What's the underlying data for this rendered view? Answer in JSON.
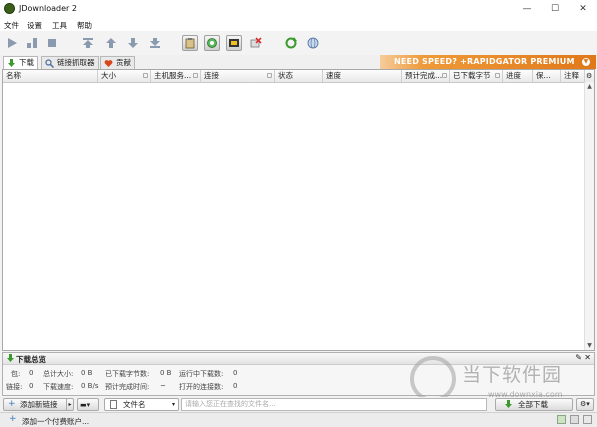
{
  "window": {
    "title": "JDownloader 2",
    "minimize": "—",
    "maximize": "☐",
    "close": "✕"
  },
  "menu": [
    "文件",
    "设置",
    "工具",
    "帮助"
  ],
  "tabs": [
    {
      "label": "下载",
      "icon": "download-icon"
    },
    {
      "label": "链接抓取器",
      "icon": "linkgrabber-icon"
    },
    {
      "label": "贡献",
      "icon": "heart-icon"
    }
  ],
  "promo": "NEED SPEED? +RAPIDGATOR PREMIUM",
  "columns": [
    "名称",
    "大小",
    "主机服务...",
    "连接",
    "状态",
    "速度",
    "预计完成...",
    "已下载字节",
    "进度",
    "保...",
    "注释"
  ],
  "summary": {
    "title": "下载总览",
    "row1": [
      {
        "label": "包:",
        "value": "0"
      },
      {
        "label": "总计大小:",
        "value": "0 B"
      },
      {
        "label": "已下载字节数:",
        "value": "0 B"
      },
      {
        "label": "运行中下载数:",
        "value": "0"
      }
    ],
    "row2": [
      {
        "label": "链接:",
        "value": "0"
      },
      {
        "label": "下载速度:",
        "value": "0 B/s"
      },
      {
        "label": "预计完成时间:",
        "value": "~"
      },
      {
        "label": "打开的连接数:",
        "value": "0"
      }
    ]
  },
  "bottom": {
    "add_links": "添加新链接",
    "filter_label": "文件名",
    "search_placeholder": "请输入您正在查找的文件名...",
    "start_all": "全部下载"
  },
  "statusbar": {
    "add_account": "添加一个付费账户..."
  },
  "watermark": {
    "text": "当下软件园",
    "url": "www.downxia.com"
  },
  "colors": {
    "accent_orange": "#e07818",
    "green": "#3b9a2c",
    "grid_bg": "#ffffff"
  }
}
